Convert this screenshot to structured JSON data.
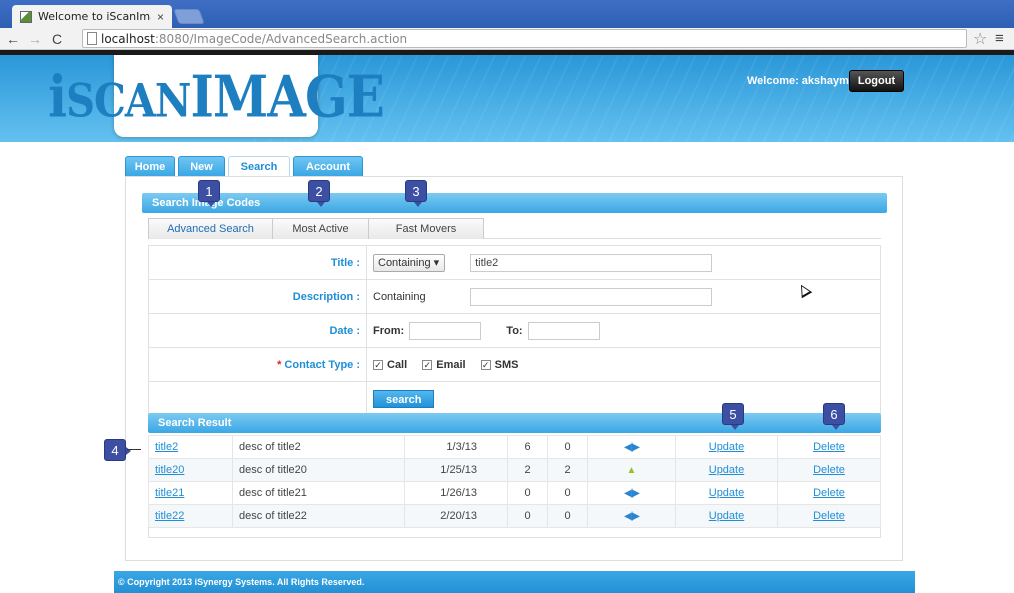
{
  "browser": {
    "tab_title": "Welcome to iScanImag",
    "tab_close": "×",
    "url_host": "localhost",
    "url_rest": ":8080/ImageCode/AdvancedSearch.action"
  },
  "header": {
    "logo_prefix": "i",
    "logo_scan": "SCAN",
    "logo_image": "IMAGE",
    "welcome": "Welcome: akshaym",
    "logout": "Logout"
  },
  "main_tabs": [
    "Home",
    "New",
    "Search",
    "Account"
  ],
  "search_section": {
    "title": "Search Image Codes",
    "sub_tabs": [
      "Advanced Search",
      "Most Active",
      "Fast Movers"
    ]
  },
  "form": {
    "title_label": "Title :",
    "title_select": "Containing",
    "title_value": "title2",
    "description_label": "Description :",
    "description_mode": "Containing",
    "date_label": "Date :",
    "from_label": "From:",
    "to_label": "To:",
    "contact_type_label": "Contact Type :",
    "required_mark": "*",
    "contact_options": [
      "Call",
      "Email",
      "SMS"
    ],
    "search_button": "search"
  },
  "results": {
    "title": "Search Result",
    "rows": [
      {
        "title": "title2",
        "desc": "desc of title2",
        "date": "1/3/13",
        "n1": "6",
        "n2": "0",
        "trend": "arrows",
        "update": "Update",
        "delete": "Delete"
      },
      {
        "title": "title20",
        "desc": "desc of title20",
        "date": "1/25/13",
        "n1": "2",
        "n2": "2",
        "trend": "up",
        "update": "Update",
        "delete": "Delete"
      },
      {
        "title": "title21",
        "desc": "desc of title21",
        "date": "1/26/13",
        "n1": "0",
        "n2": "0",
        "trend": "arrows",
        "update": "Update",
        "delete": "Delete"
      },
      {
        "title": "title22",
        "desc": "desc of title22",
        "date": "2/20/13",
        "n1": "0",
        "n2": "0",
        "trend": "arrows",
        "update": "Update",
        "delete": "Delete"
      }
    ]
  },
  "callouts": [
    "1",
    "2",
    "3",
    "4",
    "5",
    "6"
  ],
  "footer": "© Copyright 2013 iSynergy Systems. All Rights Reserved."
}
